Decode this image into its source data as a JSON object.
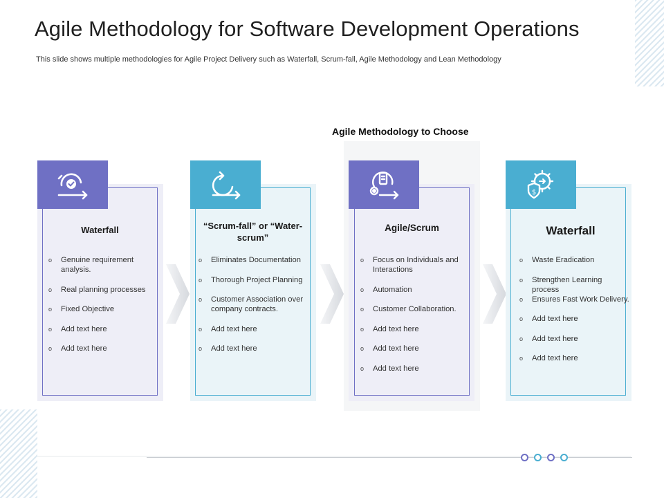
{
  "title": "Agile Methodology for Software Development Operations",
  "subtitle": "This slide shows multiple methodologies for Agile Project Delivery such as Waterfall, Scrum-fall, Agile Methodology and Lean Methodology",
  "choose_label": "Agile Methodology to Choose",
  "bullet_marker": "o",
  "colors": {
    "purple": "#6f70c4",
    "blue": "#4aaed1",
    "purple_bg": "#eeeef7",
    "blue_bg": "#eaf4f8"
  },
  "cards": [
    {
      "title": "Waterfall",
      "icon": "cycle-check-icon",
      "items": [
        "Genuine requirement analysis.",
        "Real planning processes",
        "Fixed Objective",
        "Add text here",
        "Add text here"
      ]
    },
    {
      "title": "“Scrum-fall” or “Water-scrum”",
      "icon": "loop-arrow-icon",
      "items": [
        "Eliminates Documentation",
        "Thorough Project Planning",
        "Customer Association over company contracts.",
        "Add text here",
        "Add text here"
      ]
    },
    {
      "title": "Agile/Scrum",
      "icon": "mobile-gear-icon",
      "items": [
        "Focus on Individuals and Interactions",
        "Automation",
        "Customer Collaboration.",
        "Add text here",
        "Add text here",
        "Add text here"
      ]
    },
    {
      "title": "Waterfall",
      "icon": "gear-shield-dollar-icon",
      "items": [
        "Waste Eradication",
        "Strengthen Learning process",
        "Ensures Fast Work Delivery.",
        "Add text here",
        "Add text here",
        "Add text here"
      ]
    }
  ]
}
